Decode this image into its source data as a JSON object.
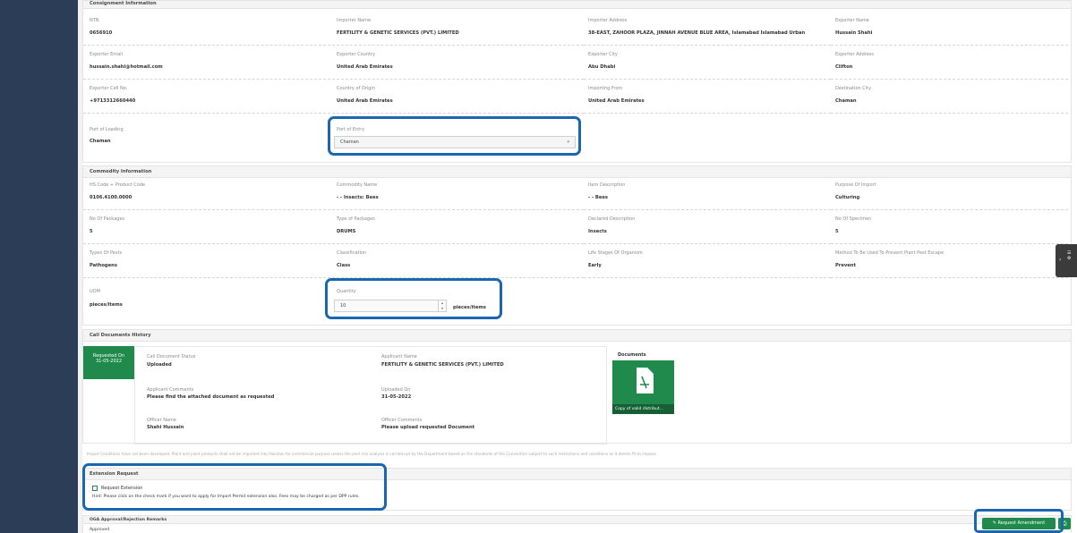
{
  "consignment": {
    "title": "Consignment Information",
    "rows": [
      [
        {
          "l": "NTN",
          "v": "0656910"
        },
        {
          "l": "Importer Name",
          "v": "FERTILITY & GENETIC SERVICES (PVT.) LIMITED"
        },
        {
          "l": "Importer Address",
          "v": "38-EAST, ZAHOOR PLAZA, JINNAH AVENUE BLUE AREA, Islamabad Islamabad Urban"
        },
        {
          "l": "Exporter Name",
          "v": "Hussain Shahi"
        }
      ],
      [
        {
          "l": "Exporter Email",
          "v": "hussain.shahi@hotmail.com"
        },
        {
          "l": "Exporter Country",
          "v": "United Arab Emirates"
        },
        {
          "l": "Exporter City",
          "v": "Abu Dhabi"
        },
        {
          "l": "Exporter Address",
          "v": "Clifton"
        }
      ],
      [
        {
          "l": "Exporter Cell No.",
          "v": "+9713312660440"
        },
        {
          "l": "Country of Origin",
          "v": "United Arab Emirates"
        },
        {
          "l": "Importing From",
          "v": "United Arab Emirates"
        },
        {
          "l": "Destination City",
          "v": "Chaman"
        }
      ]
    ],
    "port_loading_label": "Port of Loading",
    "port_loading_value": "Chaman",
    "port_entry_label": "Port of Entry",
    "port_entry_value": "Chaman"
  },
  "commodity": {
    "title": "Commodity Information",
    "rows": [
      [
        {
          "l": "HS Code + Product Code",
          "v": "0106.4100.0000"
        },
        {
          "l": "Commodity Name",
          "v": "- - Insects: Bees"
        },
        {
          "l": "Item Description",
          "v": "- - Bees"
        },
        {
          "l": "Purpose Of Import",
          "v": "Culturing"
        }
      ],
      [
        {
          "l": "No Of Packages",
          "v": "5"
        },
        {
          "l": "Type of Packages",
          "v": "DRUMS"
        },
        {
          "l": "Declared Description",
          "v": "Insects"
        },
        {
          "l": "No Of Specimen",
          "v": "5"
        }
      ],
      [
        {
          "l": "Types Of Pests",
          "v": "Pathogens"
        },
        {
          "l": "Classification",
          "v": "Class"
        },
        {
          "l": "Life Stages Of Organism",
          "v": "Early"
        },
        {
          "l": "Method To Be Used To Prevent Plant Pest Escape",
          "v": "Prevent"
        }
      ]
    ],
    "uom_label": "UOM",
    "uom_value": "pieces/items",
    "qty_label": "Quantity",
    "qty_value": "10",
    "qty_unit": "pieces/items"
  },
  "history": {
    "title": "Call Documents History",
    "req_label": "Requested On",
    "req_date": "31-05-2022",
    "status_label": "Call Document Status",
    "status_value": "Uploaded",
    "app_name_label": "Applicant Name",
    "app_name_value": "FERTILITY & GENETIC SERVICES (PVT.) LIMITED",
    "comments_label": "Applicant Comments",
    "comments_value": "Please find the attached document as requested",
    "uploaded_label": "Uploaded On",
    "uploaded_value": "31-05-2022",
    "officer_label": "Officer Name",
    "officer_value": "Shahi Hussain",
    "officer_cmt_label": "Officer Comments",
    "officer_cmt_value": "Please upload requested Document",
    "docs_label": "Documents",
    "doc_caption": "Copy of valid distribut..."
  },
  "notice": "Import Conditions have not been developed. Plant and plant products shall not be imported into Pakistan for commercial purpose unless the pest risk analysis is carried out by the Department based on the standards of the Convention subject to such restrictions and conditions as it deems fit to impose.",
  "extension": {
    "title": "Extension Request",
    "check_label": "Request Extension",
    "hint": "Hint: Please click on the check mark if you want to apply for Import Permit extension also. Fees may be charged as per DPP rules."
  },
  "remarks": {
    "title": "OGA Approval/Rejection Remarks",
    "value": "Approved"
  },
  "actions": {
    "amend": "Request Amendment"
  },
  "icons": {
    "print": "print-icon",
    "pencil": "pencil-icon",
    "pdf": "pdf-icon",
    "chevron": "chevron-right-icon"
  },
  "colors": {
    "sidebar": "#2c3d57",
    "accent": "#1f8a4c",
    "highlight": "#1a66b0"
  }
}
